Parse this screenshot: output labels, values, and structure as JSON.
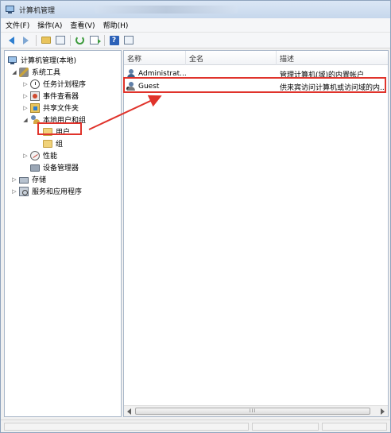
{
  "window": {
    "title": "计算机管理"
  },
  "menu": {
    "items": [
      "文件(F)",
      "操作(A)",
      "查看(V)",
      "帮助(H)"
    ]
  },
  "toolbar": {
    "buttons": [
      "back-arrow-icon",
      "forward-arrow-icon",
      "up-folder-icon",
      "show-hide-tree-icon",
      "refresh-icon",
      "export-list-icon",
      "help-icon",
      "properties-icon"
    ],
    "help_glyph": "?"
  },
  "tree": {
    "root": "计算机管理(本地)",
    "system_tools": "系统工具",
    "task_scheduler": "任务计划程序",
    "event_viewer": "事件查看器",
    "shared_folders": "共享文件夹",
    "local_users_groups": "本地用户和组",
    "users": "用户",
    "groups": "组",
    "performance": "性能",
    "device_manager": "设备管理器",
    "storage": "存储",
    "services_apps": "服务和应用程序"
  },
  "list": {
    "columns": [
      "名称",
      "全名",
      "描述"
    ],
    "rows": [
      {
        "name": "Administrat...",
        "full_name": "",
        "description": "管理计算机(域)的内置帐户"
      },
      {
        "name": "Guest",
        "full_name": "",
        "description": "供来宾访问计算机或访问域的内..."
      }
    ]
  },
  "scrollbar": {
    "grip": "III"
  },
  "colors": {
    "highlight": "#e0332b",
    "window_border": "#8ea3bd",
    "titlebar": "#c6d7ec"
  }
}
